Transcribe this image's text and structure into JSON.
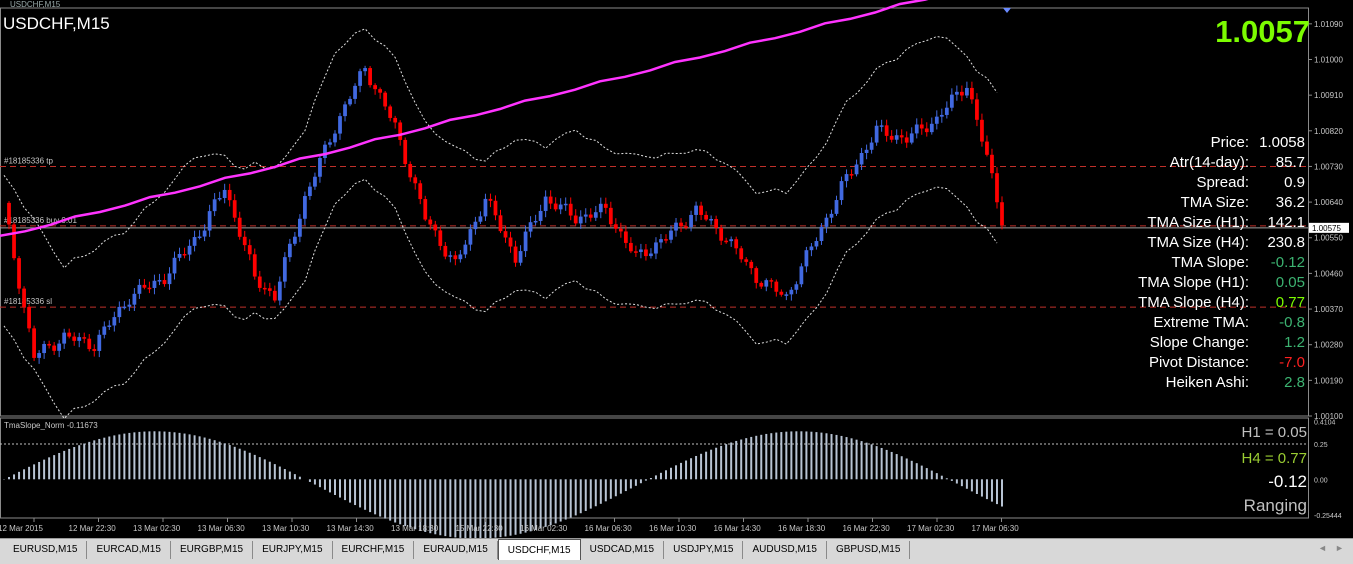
{
  "window": {
    "title": "USDCHF,M15",
    "tiny_title": "USDCHF,M15",
    "current_price": "1.0057"
  },
  "chart": {
    "price_axis_labels": [
      "1.01090",
      "1.01000",
      "1.00910",
      "1.00820",
      "1.00730",
      "1.00640",
      "1.00575",
      "1.00550",
      "1.00460",
      "1.00370",
      "1.00280",
      "1.00190",
      "1.00100"
    ],
    "current_price_tag": "1.00575",
    "order_lines": {
      "tp": "#18185336 tp",
      "buy": "#18185336 buy 0.01",
      "sl": "#18185336 sl"
    },
    "time_axis_labels": [
      "12 Mar 2015",
      "12 Mar 22:30",
      "13 Mar 02:30",
      "13 Mar 06:30",
      "13 Mar 10:30",
      "13 Mar 14:30",
      "13 Mar 18:30",
      "15 Mar 22:30",
      "16 Mar 02:30",
      "16 Mar 06:30",
      "16 Mar 10:30",
      "16 Mar 14:30",
      "16 Mar 18:30",
      "16 Mar 22:30",
      "17 Mar 02:30",
      "17 Mar 06:30"
    ],
    "colors": {
      "bull": "#4169e1",
      "bear": "#ff0000",
      "trend_line": "#ff33ff",
      "order_line": "#c0302a",
      "positive": "#3cb371",
      "negative": "#ff2020",
      "strong_positive": "#7cfc00"
    }
  },
  "stats": [
    {
      "label": "Price:",
      "value": "1.0058",
      "color": "#ffffff"
    },
    {
      "label": "Atr(14-day):",
      "value": "85.7",
      "color": "#ffffff"
    },
    {
      "label": "Spread:",
      "value": "0.9",
      "color": "#ffffff"
    },
    {
      "label": "TMA Size:",
      "value": "36.2",
      "color": "#ffffff"
    },
    {
      "label": "TMA Size (H1):",
      "value": "142.1",
      "color": "#ffffff"
    },
    {
      "label": "TMA Size (H4):",
      "value": "230.8",
      "color": "#ffffff"
    },
    {
      "label": "TMA Slope:",
      "value": "-0.12",
      "color": "#3cb371"
    },
    {
      "label": "TMA Slope (H1):",
      "value": "0.05",
      "color": "#3cb371"
    },
    {
      "label": "TMA Slope (H4):",
      "value": "0.77",
      "color": "#7cfc00"
    },
    {
      "label": "Extreme TMA:",
      "value": "-0.8",
      "color": "#3cb371"
    },
    {
      "label": "Slope Change:",
      "value": "1.2",
      "color": "#3cb371"
    },
    {
      "label": "Pivot Distance:",
      "value": "-7.0",
      "color": "#ff2020"
    },
    {
      "label": "Heiken Ashi:",
      "value": "2.8",
      "color": "#3cb371"
    }
  ],
  "indicator": {
    "title": "TmaSlope_Norm -0.11673",
    "h1": "H1 = 0.05",
    "h4": "H4 = 0.77",
    "current": "-0.12",
    "state": "Ranging",
    "axis_labels": [
      "0.4104",
      "0.25",
      "0.00",
      "-0.25444"
    ]
  },
  "tabs": [
    {
      "label": "EURUSD,M15",
      "active": false
    },
    {
      "label": "EURCAD,M15",
      "active": false
    },
    {
      "label": "EURGBP,M15",
      "active": false
    },
    {
      "label": "EURJPY,M15",
      "active": false
    },
    {
      "label": "EURCHF,M15",
      "active": false
    },
    {
      "label": "EURAUD,M15",
      "active": false
    },
    {
      "label": "USDCHF,M15",
      "active": true
    },
    {
      "label": "USDCAD,M15",
      "active": false
    },
    {
      "label": "USDJPY,M15",
      "active": false
    },
    {
      "label": "AUDUSD,M15",
      "active": false
    },
    {
      "label": "GBPUSD,M15",
      "active": false
    }
  ],
  "tab_scroll": {
    "left": "◄",
    "right": "►"
  }
}
